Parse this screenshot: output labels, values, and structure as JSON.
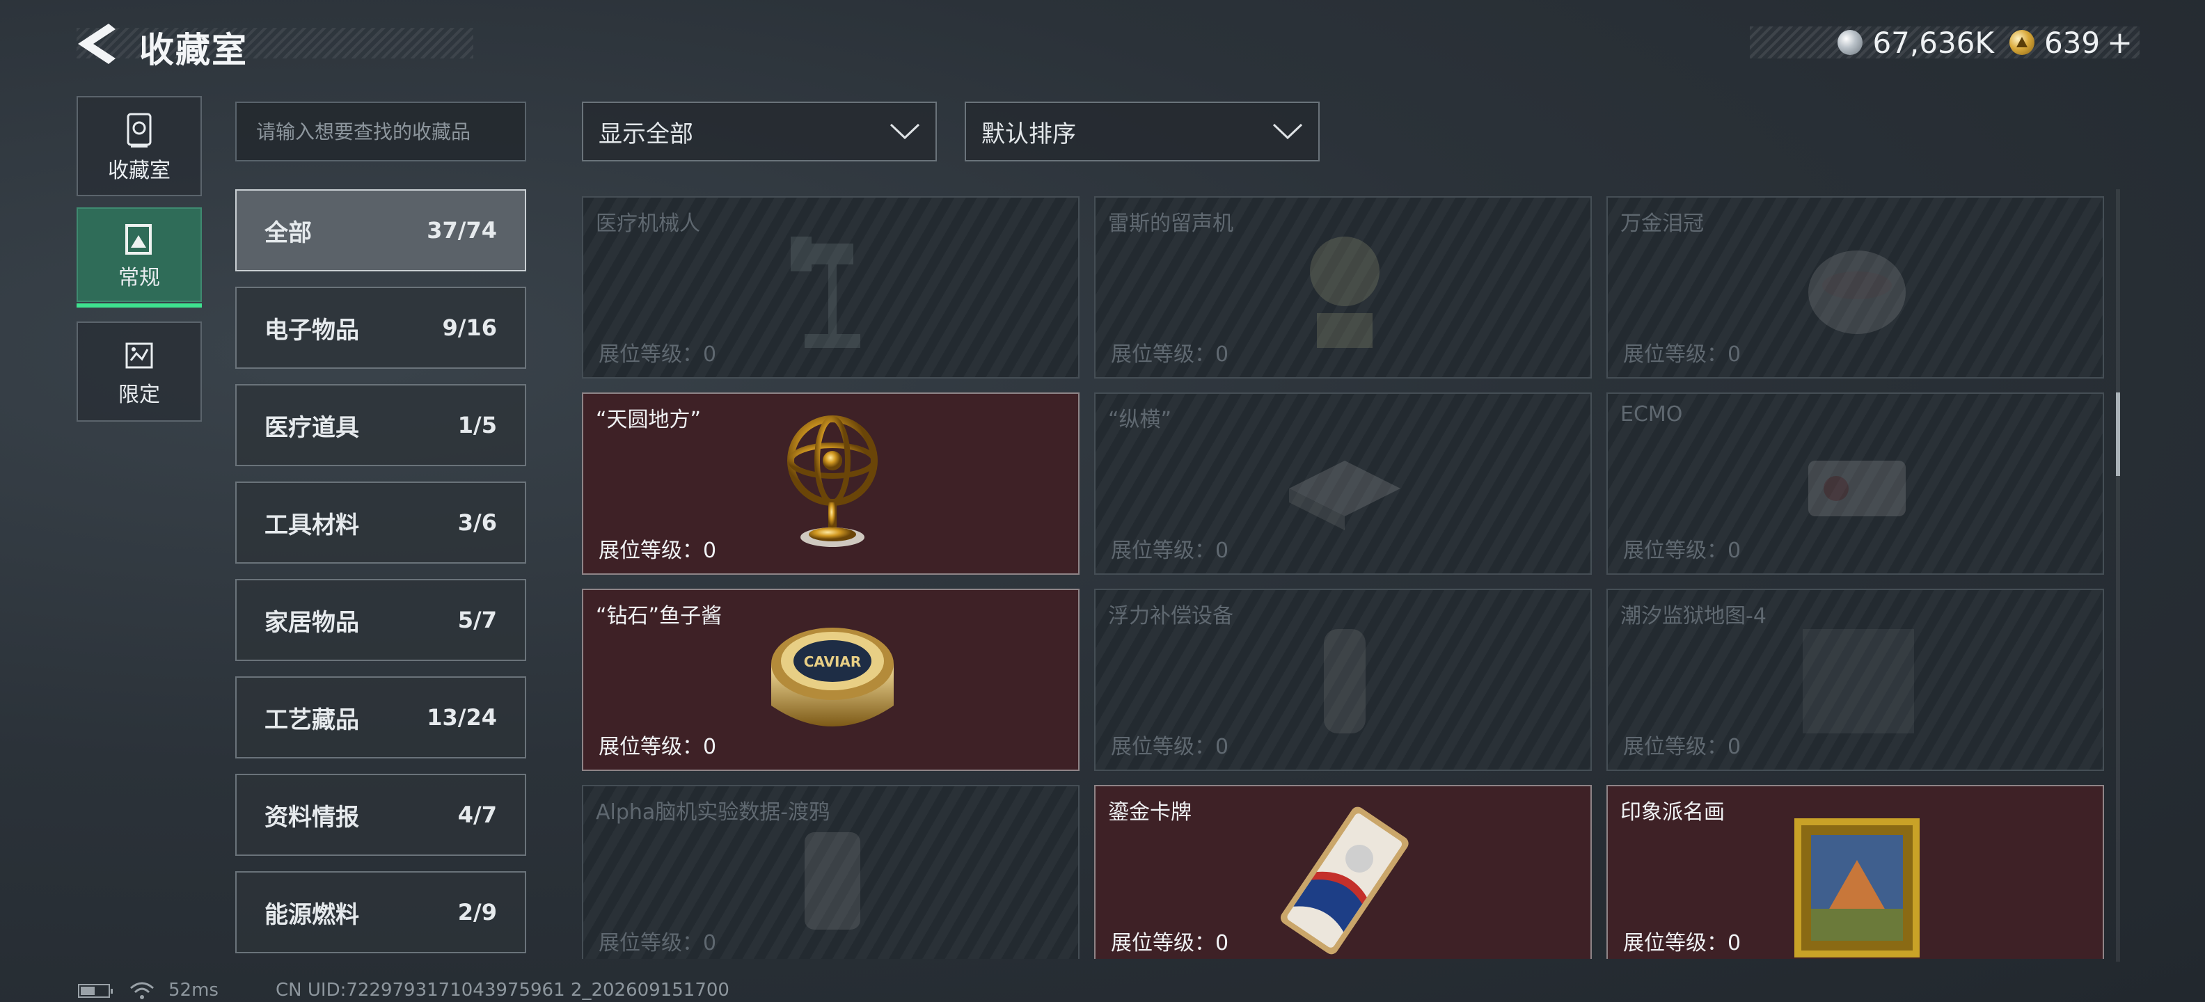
{
  "header": {
    "title": "收藏室",
    "currency": [
      {
        "icon": "silver-coin-icon",
        "value": "67,636K"
      },
      {
        "icon": "gold-coin-icon",
        "value": "639"
      }
    ],
    "plus": "+"
  },
  "rail": [
    {
      "label": "收藏室",
      "icon": "vault-icon"
    },
    {
      "label": "常规",
      "icon": "image-frame-icon",
      "active": true
    },
    {
      "label": "限定",
      "icon": "limited-icon"
    }
  ],
  "search": {
    "placeholder": "请输入想要查找的收藏品"
  },
  "categories": [
    {
      "name": "全部",
      "count": "37/74",
      "active": true
    },
    {
      "name": "电子物品",
      "count": "9/16"
    },
    {
      "name": "医疗道具",
      "count": "1/5"
    },
    {
      "name": "工具材料",
      "count": "3/6"
    },
    {
      "name": "家居物品",
      "count": "5/7"
    },
    {
      "name": "工艺藏品",
      "count": "13/24"
    },
    {
      "name": "资料情报",
      "count": "4/7"
    },
    {
      "name": "能源燃料",
      "count": "2/9"
    }
  ],
  "filters": {
    "show": "显示全部",
    "sort": "默认排序"
  },
  "items": [
    {
      "name": "医疗机械人",
      "level": "展位等级：0",
      "owned": false,
      "icon": "medical-robot-icon"
    },
    {
      "name": "雷斯的留声机",
      "level": "展位等级：0",
      "owned": false,
      "icon": "gramophone-icon"
    },
    {
      "name": "万金泪冠",
      "level": "展位等级：0",
      "owned": false,
      "icon": "crown-icon"
    },
    {
      "name": "“天圆地方”",
      "level": "展位等级：0",
      "owned": true,
      "icon": "armillary-sphere-icon"
    },
    {
      "name": "“纵横”",
      "level": "展位等级：0",
      "owned": false,
      "icon": "chess-board-icon"
    },
    {
      "name": "ECMO",
      "level": "展位等级：0",
      "owned": false,
      "icon": "ecmo-machine-icon"
    },
    {
      "name": "“钻石”鱼子酱",
      "level": "展位等级：0",
      "owned": true,
      "icon": "caviar-tin-icon",
      "label": "CAVIAR"
    },
    {
      "name": "浮力补偿设备",
      "level": "展位等级：0",
      "owned": false,
      "icon": "buoyancy-device-icon"
    },
    {
      "name": "潮汐监狱地图-4",
      "level": "展位等级：0",
      "owned": false,
      "icon": "map-icon"
    },
    {
      "name": "Alpha脑机实验数据-渡鸦",
      "level": "展位等级：0",
      "owned": false,
      "icon": "data-canister-icon"
    },
    {
      "name": "鎏金卡牌",
      "level": "展位等级：0",
      "owned": true,
      "icon": "gilded-card-icon"
    },
    {
      "name": "印象派名画",
      "level": "展位等级：0",
      "owned": true,
      "icon": "framed-painting-icon"
    }
  ],
  "status": {
    "ping": "52ms",
    "uid": "CN UID:7229793171043975961 2_202609151700"
  },
  "colors": {
    "accent": "#3ee28f",
    "owned_card": "#3e2126",
    "active_rail": "#2f6c58"
  }
}
